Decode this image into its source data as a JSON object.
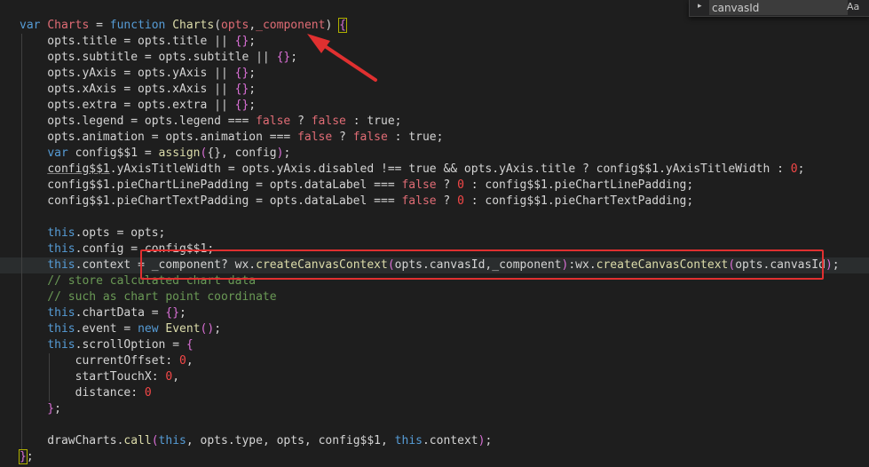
{
  "find_widget": {
    "toggle_glyph": "▸",
    "value": "canvasId",
    "case_label": "Aa"
  },
  "code_lines": [
    [
      [
        "k",
        "var "
      ],
      [
        "i",
        "Charts"
      ],
      [
        "p",
        " = "
      ],
      [
        "k",
        "function "
      ],
      [
        "f",
        "Charts"
      ],
      [
        "p",
        "("
      ],
      [
        "i",
        "opts"
      ],
      [
        "p",
        ","
      ],
      [
        "i",
        "_component"
      ],
      [
        "p",
        ") "
      ],
      [
        "bh",
        "{"
      ]
    ],
    [
      [
        "p",
        "    opts.title = opts.title || "
      ],
      [
        "b",
        "{}"
      ],
      [
        "p",
        ";"
      ]
    ],
    [
      [
        "p",
        "    opts.subtitle = opts.subtitle || "
      ],
      [
        "b",
        "{}"
      ],
      [
        "p",
        ";"
      ]
    ],
    [
      [
        "p",
        "    opts.yAxis = opts.yAxis || "
      ],
      [
        "b",
        "{}"
      ],
      [
        "p",
        ";"
      ]
    ],
    [
      [
        "p",
        "    opts.xAxis = opts.xAxis || "
      ],
      [
        "b",
        "{}"
      ],
      [
        "p",
        ";"
      ]
    ],
    [
      [
        "p",
        "    opts.extra = opts.extra || "
      ],
      [
        "b",
        "{}"
      ],
      [
        "p",
        ";"
      ]
    ],
    [
      [
        "p",
        "    opts.legend = opts.legend === "
      ],
      [
        "i",
        "false"
      ],
      [
        "p",
        " ? "
      ],
      [
        "i",
        "false"
      ],
      [
        "p",
        " : "
      ],
      [
        "p",
        "true"
      ],
      [
        "p",
        ";"
      ]
    ],
    [
      [
        "p",
        "    opts.animation = opts.animation === "
      ],
      [
        "i",
        "false"
      ],
      [
        "p",
        " ? "
      ],
      [
        "i",
        "false"
      ],
      [
        "p",
        " : "
      ],
      [
        "p",
        "true"
      ],
      [
        "p",
        ";"
      ]
    ],
    [
      [
        "p",
        "    "
      ],
      [
        "k",
        "var "
      ],
      [
        "p",
        "config$$1 = "
      ],
      [
        "f",
        "assign"
      ],
      [
        "b",
        "("
      ],
      [
        "p",
        "{}, config"
      ],
      [
        "b",
        ")"
      ],
      [
        "p",
        ";"
      ]
    ],
    [
      [
        "p",
        "    "
      ],
      [
        "u",
        "config$$1"
      ],
      [
        "p",
        ".yAxisTitleWidth = opts.yAxis.disabled !== "
      ],
      [
        "p",
        "true"
      ],
      [
        "p",
        " && opts.yAxis.title ? config$$1.yAxisTitleWidth : "
      ],
      [
        "n",
        "0"
      ],
      [
        "p",
        ";"
      ]
    ],
    [
      [
        "p",
        "    config$$1.pieChartLinePadding = opts.dataLabel === "
      ],
      [
        "i",
        "false"
      ],
      [
        "p",
        " ? "
      ],
      [
        "n",
        "0"
      ],
      [
        "p",
        " : config$$1.pieChartLinePadding;"
      ]
    ],
    [
      [
        "p",
        "    config$$1.pieChartTextPadding = opts.dataLabel === "
      ],
      [
        "i",
        "false"
      ],
      [
        "p",
        " ? "
      ],
      [
        "n",
        "0"
      ],
      [
        "p",
        " : config$$1.pieChartTextPadding;"
      ]
    ],
    [],
    [
      [
        "p",
        "    "
      ],
      [
        "k",
        "this"
      ],
      [
        "p",
        ".opts = opts;"
      ]
    ],
    [
      [
        "p",
        "    "
      ],
      [
        "k",
        "this"
      ],
      [
        "p",
        ".config = config$$1;"
      ]
    ],
    [
      [
        "p",
        "    "
      ],
      [
        "k",
        "this"
      ],
      [
        "p",
        ".context = _component? wx."
      ],
      [
        "f",
        "createCanvasContext"
      ],
      [
        "b",
        "("
      ],
      [
        "p",
        "opts.canvasId,_component"
      ],
      [
        "b",
        ")"
      ],
      [
        "p",
        ":wx."
      ],
      [
        "f",
        "createCanvasContext"
      ],
      [
        "b",
        "("
      ],
      [
        "p",
        "opts.canvasId"
      ],
      [
        "b",
        ")"
      ],
      [
        "p",
        ";"
      ]
    ],
    [
      [
        "c",
        "    // store calculated chart data"
      ]
    ],
    [
      [
        "c",
        "    // such as chart point coordinate"
      ]
    ],
    [
      [
        "p",
        "    "
      ],
      [
        "k",
        "this"
      ],
      [
        "p",
        ".chartData = "
      ],
      [
        "b",
        "{}"
      ],
      [
        "p",
        ";"
      ]
    ],
    [
      [
        "p",
        "    "
      ],
      [
        "k",
        "this"
      ],
      [
        "p",
        ".event = "
      ],
      [
        "k",
        "new "
      ],
      [
        "f",
        "Event"
      ],
      [
        "b",
        "()"
      ],
      [
        "p",
        ";"
      ]
    ],
    [
      [
        "p",
        "    "
      ],
      [
        "k",
        "this"
      ],
      [
        "p",
        ".scrollOption = "
      ],
      [
        "b",
        "{"
      ]
    ],
    [
      [
        "p",
        "        currentOffset: "
      ],
      [
        "n",
        "0"
      ],
      [
        "p",
        ","
      ]
    ],
    [
      [
        "p",
        "        startTouchX: "
      ],
      [
        "n",
        "0"
      ],
      [
        "p",
        ","
      ]
    ],
    [
      [
        "p",
        "        distance: "
      ],
      [
        "n",
        "0"
      ]
    ],
    [
      [
        "b",
        "    }"
      ],
      [
        "p",
        ";"
      ]
    ],
    [],
    [
      [
        "p",
        "    drawCharts."
      ],
      [
        "f",
        "call"
      ],
      [
        "b",
        "("
      ],
      [
        "k",
        "this"
      ],
      [
        "p",
        ", opts.type, opts, config$$1, "
      ],
      [
        "k",
        "this"
      ],
      [
        "p",
        ".context"
      ],
      [
        "b",
        ")"
      ],
      [
        "p",
        ";"
      ]
    ],
    [
      [
        "bh",
        "}"
      ],
      [
        "p",
        ";"
      ]
    ]
  ]
}
